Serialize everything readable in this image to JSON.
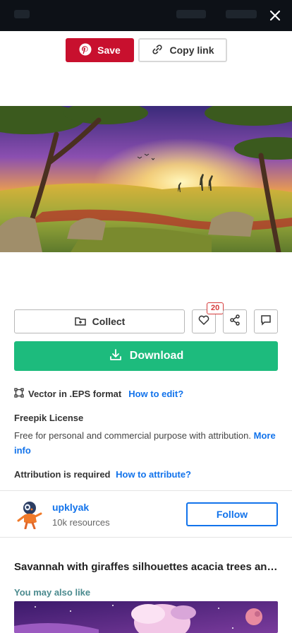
{
  "share": {
    "save_label": "Save",
    "copy_label": "Copy link"
  },
  "actions": {
    "collect_label": "Collect",
    "likes_count": "20",
    "download_label": "Download"
  },
  "format": {
    "text": "Vector in .EPS format",
    "how_to_edit": "How to edit?"
  },
  "license": {
    "title": "Freepik License",
    "text": "Free for personal and commercial purpose with attribution.",
    "more_info": "More info",
    "attribution_label": "Attribution is required",
    "how_to_attribute": "How to attribute?"
  },
  "author": {
    "name": "upklyak",
    "resources": "10k resources",
    "follow_label": "Follow"
  },
  "resource_title": "Savannah with giraffes silhouettes acacia trees and sunset",
  "related_heading": "You may also like",
  "colors": {
    "save": "#c8102e",
    "download": "#1dbb7d",
    "link": "#1273eb",
    "related": "#4a8a8e",
    "badge": "#d63a3a"
  },
  "icons": [
    "close-icon",
    "pinterest-icon",
    "link-icon",
    "collection-icon",
    "heart-icon",
    "share-icon",
    "comment-icon",
    "download-icon",
    "vector-icon"
  ]
}
